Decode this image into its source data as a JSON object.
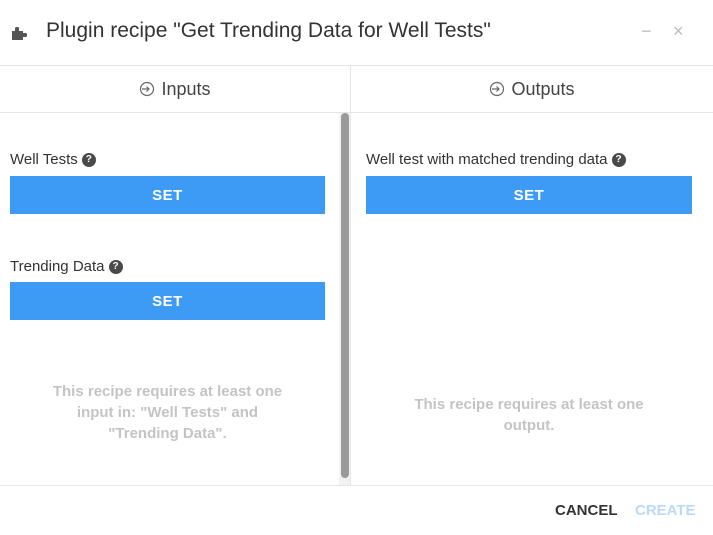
{
  "dialog": {
    "title": "Plugin recipe \"Get Trending Data for Well Tests\"",
    "icon": "puzzle-piece-icon",
    "minimize_glyph": "−",
    "close_glyph": "×"
  },
  "columns": {
    "inputs": {
      "label": "Inputs",
      "icon": "sign-in-icon"
    },
    "outputs": {
      "label": "Outputs",
      "icon": "sign-in-icon"
    }
  },
  "inputs": [
    {
      "label": "Well Tests",
      "help": "?",
      "button": "SET"
    },
    {
      "label": "Trending Data",
      "help": "?",
      "button": "SET"
    }
  ],
  "inputs_hint": [
    "This recipe requires at least one",
    "input in: \"Well Tests\" and",
    "\"Trending Data\"."
  ],
  "outputs": [
    {
      "label": "Well test with matched trending data",
      "help": "?",
      "button": "SET"
    }
  ],
  "outputs_hint": [
    "This recipe requires at least one",
    "output."
  ],
  "footer": {
    "cancel": "CANCEL",
    "create": "CREATE"
  },
  "colors": {
    "accent": "#3d9bf5",
    "disabled": "#b9dbf8",
    "hint": "#c4c4c4"
  }
}
